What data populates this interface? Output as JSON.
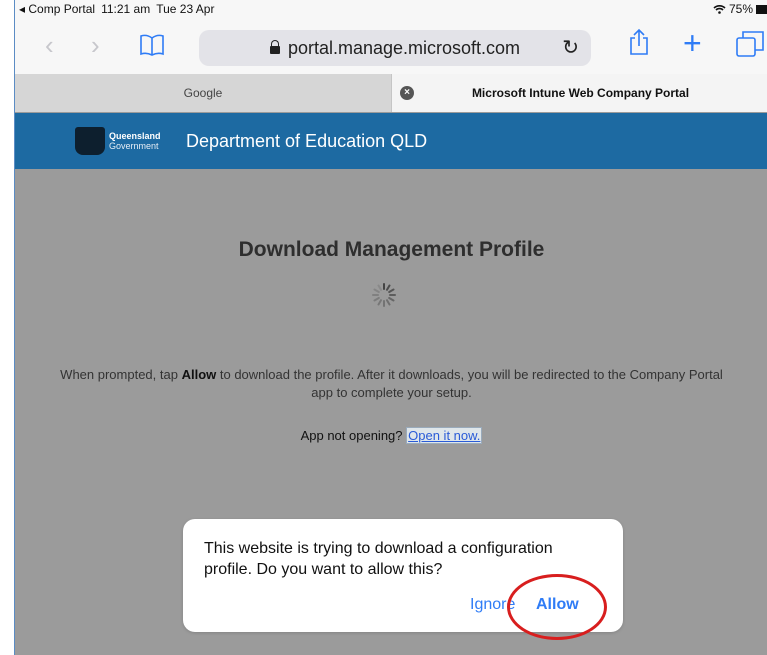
{
  "status": {
    "back_app": "◂ Comp Portal",
    "time": "11:21 am",
    "date": "Tue 23 Apr",
    "wifi_icon": "wifi-icon",
    "battery": "75%"
  },
  "toolbar": {
    "back_icon": "‹",
    "forward_icon": "›",
    "bookmarks_icon": "book-icon",
    "url": "portal.manage.microsoft.com",
    "reload_icon": "↻",
    "share_icon": "share-icon",
    "new_tab_icon": "+",
    "tabs_icon": "tabs-icon"
  },
  "tabs": [
    {
      "label": "Google",
      "active": false
    },
    {
      "label": "Microsoft Intune Web Company Portal",
      "active": true
    }
  ],
  "header": {
    "logo_line1": "Queensland",
    "logo_line2": "Government",
    "title": "Department of Education QLD"
  },
  "main": {
    "title": "Download Management Profile",
    "instruction_pre": "When prompted, tap ",
    "instruction_bold": "Allow",
    "instruction_post": " to download the profile. After it downloads, you will be redirected to the Company Portal app to complete your setup.",
    "open_prompt": "App not opening?",
    "open_link": "Open it now."
  },
  "dialog": {
    "message": "This website is trying to download a configuration profile. Do you want to allow this?",
    "ignore_label": "Ignore",
    "allow_label": "Allow"
  },
  "colors": {
    "header_bg": "#1d6aa2",
    "ios_blue": "#2f7cf6",
    "annotation_red": "#d81e1e"
  }
}
